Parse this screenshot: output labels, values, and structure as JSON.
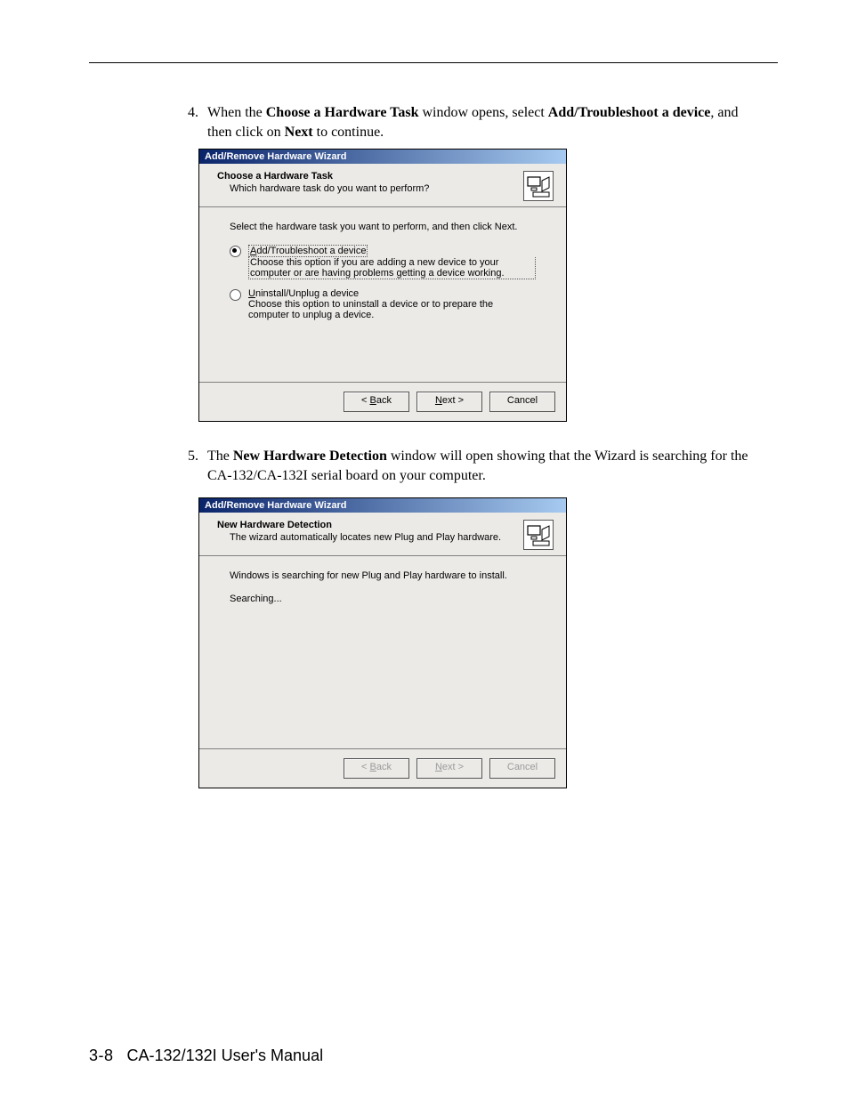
{
  "step4": {
    "num": "4.",
    "t1": "When the ",
    "b1": "Choose a Hardware Task",
    "t2": " window opens, select ",
    "b2": "Add/Troubleshoot a device",
    "t3": ", and then click on ",
    "b3": "Next",
    "t4": " to continue."
  },
  "dlg1": {
    "title": "Add/Remove Hardware Wizard",
    "heading": "Choose a Hardware Task",
    "sub": "Which hardware task do you want to perform?",
    "instr": "Select the hardware task you want to perform, and then click Next.",
    "opt1": {
      "label_pre": "A",
      "label_rest": "dd/Troubleshoot a device",
      "desc": "Choose this option if you are adding a new device to your computer or are having problems getting a device working."
    },
    "opt2": {
      "label_pre": "U",
      "label_rest": "ninstall/Unplug a device",
      "desc": "Choose this option to uninstall a device or to prepare the computer to unplug a device."
    },
    "back_pre": "< ",
    "back_u": "B",
    "back_rest": "ack",
    "next_u": "N",
    "next_rest": "ext >",
    "cancel": "Cancel"
  },
  "step5": {
    "num": "5.",
    "t1": "The ",
    "b1": "New Hardware Detection",
    "t2": " window will open showing that the Wizard is searching for the CA-132/CA-132I serial board on your computer."
  },
  "dlg2": {
    "title": "Add/Remove Hardware Wizard",
    "heading": "New Hardware Detection",
    "sub": "The wizard automatically locates new Plug and Play hardware.",
    "line1": "Windows is searching for new Plug and Play hardware to install.",
    "line2": "Searching...",
    "back_pre": "< ",
    "back_u": "B",
    "back_rest": "ack",
    "next_u": "N",
    "next_rest": "ext >",
    "cancel": "Cancel"
  },
  "footer": {
    "page": "3-8",
    "title": "CA-132/132I User's Manual"
  }
}
